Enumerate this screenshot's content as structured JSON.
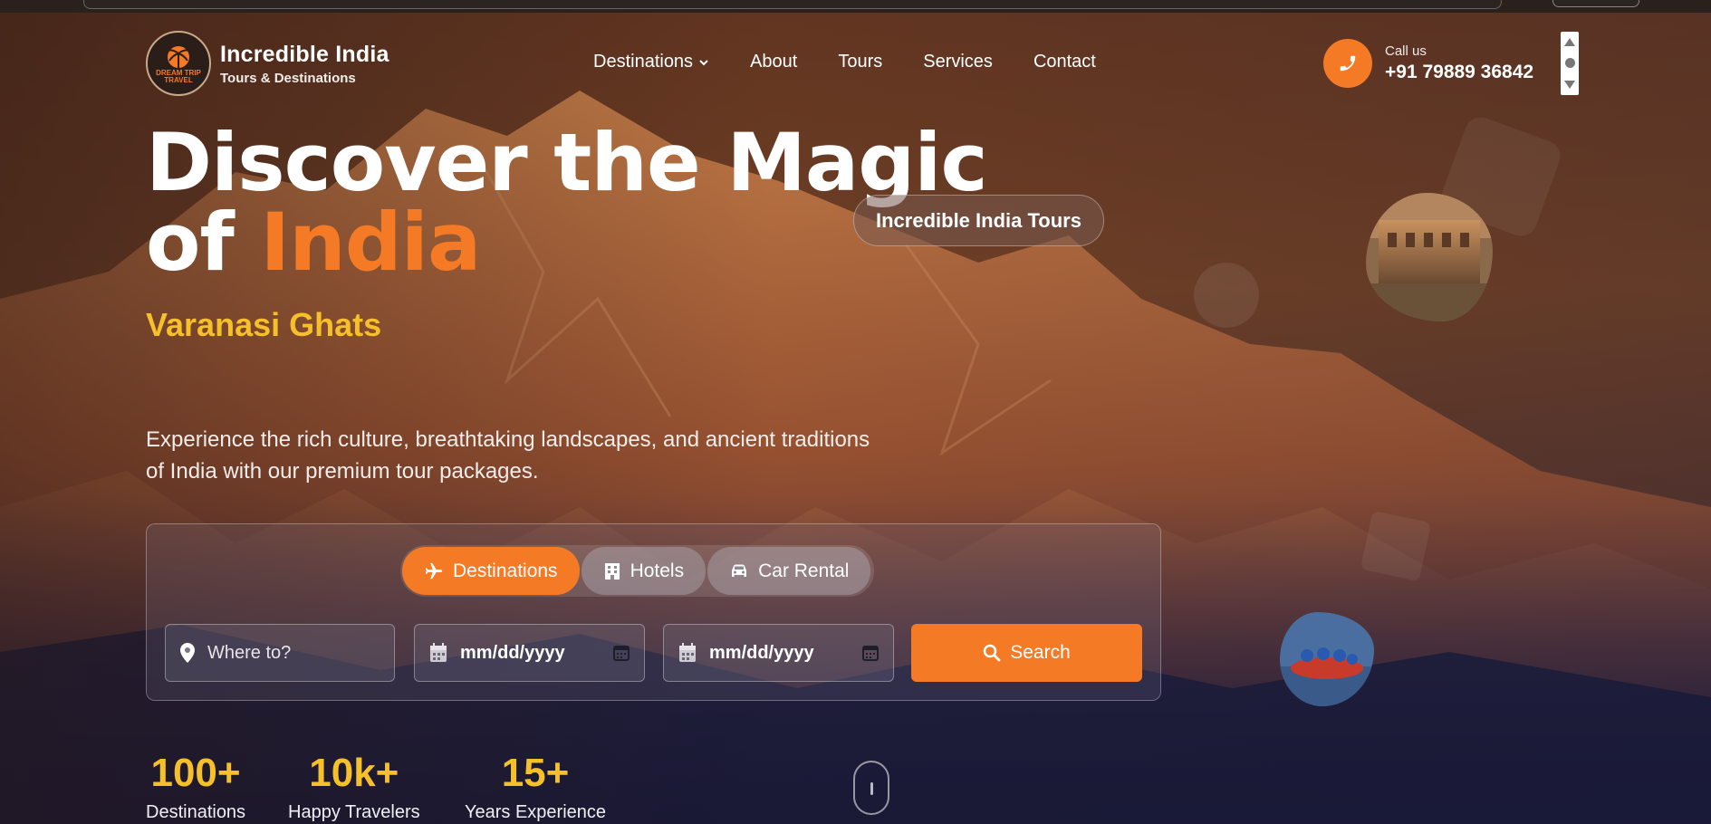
{
  "brand": {
    "title": "Incredible India",
    "subtitle": "Tours & Destinations",
    "badge_text": "DREAM TRIP TRAVEL"
  },
  "nav": {
    "items": [
      {
        "label": "Destinations",
        "has_dropdown": true
      },
      {
        "label": "About"
      },
      {
        "label": "Tours"
      },
      {
        "label": "Services"
      },
      {
        "label": "Contact"
      }
    ]
  },
  "contact": {
    "label": "Call us",
    "phone": "+91 79889 36842",
    "icon": "phone-icon"
  },
  "hero": {
    "title_line1": "Discover the Magic",
    "title_line2_prefix": "of ",
    "title_line2_accent": "India",
    "tag": "Incredible India Tours",
    "place": "Varanasi Ghats",
    "description": "Experience the rich culture, breathtaking landscapes, and ancient traditions of India with our premium tour packages."
  },
  "search": {
    "tabs": [
      {
        "label": "Destinations",
        "icon": "plane-icon",
        "active": true
      },
      {
        "label": "Hotels",
        "icon": "building-icon",
        "active": false
      },
      {
        "label": "Car Rental",
        "icon": "car-icon",
        "active": false
      }
    ],
    "where_placeholder": "Where to?",
    "checkin_value": "mm/dd/yyyy",
    "checkout_value": "mm/dd/yyyy",
    "button_label": "Search"
  },
  "stats": [
    {
      "value": "100+",
      "label": "Destinations"
    },
    {
      "value": "10k+",
      "label": "Happy Travelers"
    },
    {
      "value": "15+",
      "label": "Years Experience"
    }
  ],
  "colors": {
    "accent": "#f47a25",
    "highlight": "#f5c02a"
  }
}
